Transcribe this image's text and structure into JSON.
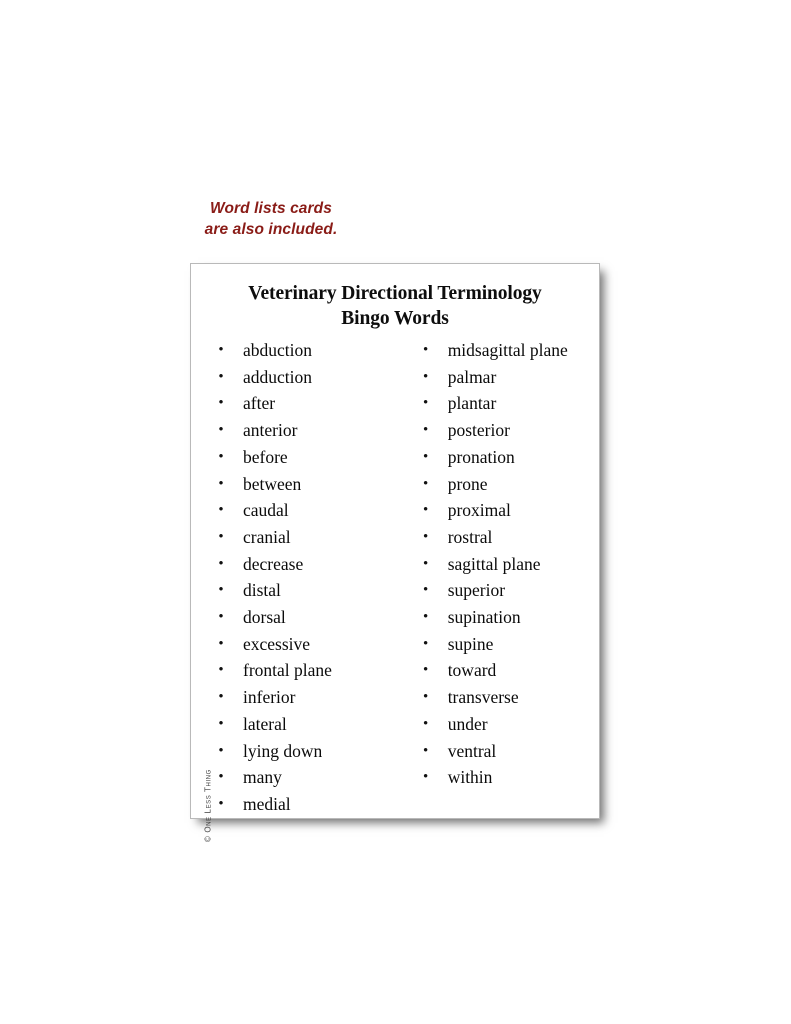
{
  "note": {
    "line1": "Word lists cards",
    "line2": "are also included.",
    "color": "#8a1c17"
  },
  "card": {
    "title_line1": "Veterinary Directional Terminology",
    "title_line2": "Bingo Words",
    "bullet_glyph": "•",
    "copyright": "© One Less Thing",
    "border_color": "#b9b9b9",
    "background": "#ffffff",
    "left_column": [
      "abduction",
      "adduction",
      "after",
      "anterior",
      "before",
      "between",
      "caudal",
      "cranial",
      "decrease",
      "distal",
      "dorsal",
      "excessive",
      "frontal plane",
      "inferior",
      "lateral",
      "lying down",
      "many",
      "medial"
    ],
    "right_column": [
      "midsagittal plane",
      "palmar",
      "plantar",
      "posterior",
      "pronation",
      "prone",
      "proximal",
      "rostral",
      "sagittal plane",
      "superior",
      "supination",
      "supine",
      "toward",
      "transverse",
      "under",
      "ventral",
      "within"
    ]
  }
}
